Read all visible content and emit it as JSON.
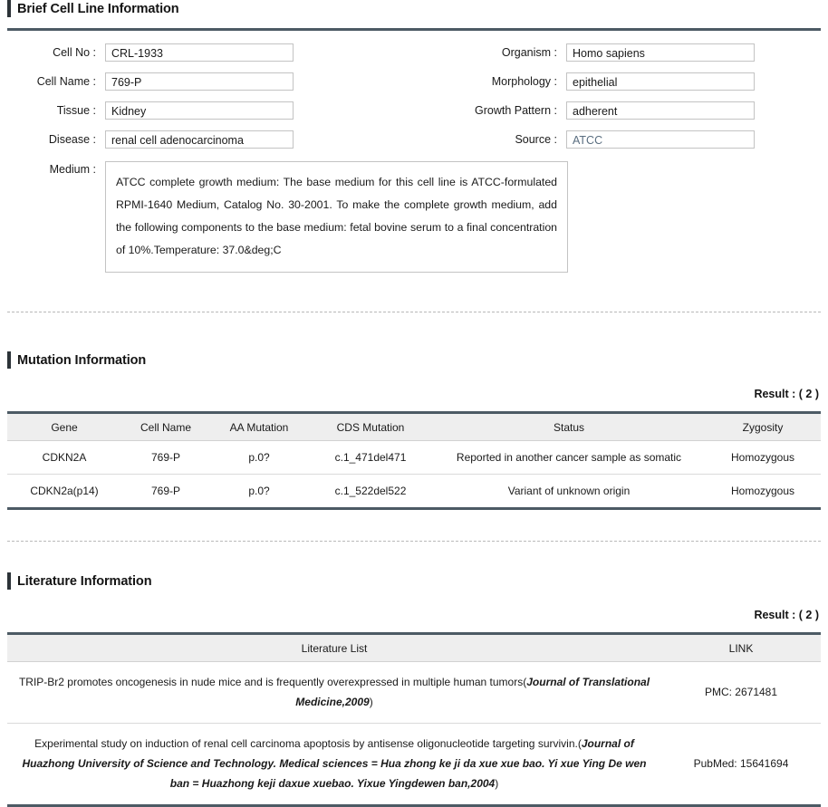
{
  "brief": {
    "section_title": "Brief Cell Line Information",
    "left_fields": [
      {
        "label": "Cell No :",
        "value": "CRL-1933",
        "muted": false
      },
      {
        "label": "Cell Name :",
        "value": "769-P",
        "muted": false
      },
      {
        "label": "Tissue :",
        "value": "Kidney",
        "muted": false
      },
      {
        "label": "Disease :",
        "value": "renal cell adenocarcinoma",
        "muted": false
      }
    ],
    "right_fields": [
      {
        "label": "Organism :",
        "value": "Homo sapiens",
        "muted": false
      },
      {
        "label": "Morphology :",
        "value": "epithelial",
        "muted": false
      },
      {
        "label": "Growth Pattern :",
        "value": "adherent",
        "muted": false
      },
      {
        "label": "Source :",
        "value": "ATCC",
        "muted": true
      }
    ],
    "medium_label": "Medium :",
    "medium_value": "ATCC complete growth medium: The base medium for this cell line is ATCC-formulated RPMI-1640 Medium, Catalog No. 30-2001. To make the complete growth medium, add the following components to the base medium: fetal bovine serum to a final concentration of 10%.Temperature: 37.0&deg;C"
  },
  "mutation": {
    "section_title": "Mutation Information",
    "result_label": "Result : ( 2 )",
    "columns": [
      "Gene",
      "Cell Name",
      "AA Mutation",
      "CDS Mutation",
      "Status",
      "Zygosity"
    ],
    "rows": [
      {
        "gene": "CDKN2A",
        "cell_name": "769-P",
        "aa_mutation": "p.0?",
        "cds_mutation": "c.1_471del471",
        "status": "Reported in another cancer sample as somatic",
        "zygosity": "Homozygous"
      },
      {
        "gene": "CDKN2a(p14)",
        "cell_name": "769-P",
        "aa_mutation": "p.0?",
        "cds_mutation": "c.1_522del522",
        "status": "Variant of unknown origin",
        "zygosity": "Homozygous"
      }
    ]
  },
  "literature": {
    "section_title": "Literature Information",
    "result_label": "Result : ( 2 )",
    "columns": [
      "Literature List",
      "LINK"
    ],
    "rows": [
      {
        "title": "TRIP-Br2 promotes oncogenesis in nude mice and is frequently overexpressed in multiple human tumors(",
        "journal": "Journal of Translational Medicine,",
        "year": "2009",
        "close": ")",
        "link": "PMC: 2671481"
      },
      {
        "title": "Experimental study on induction of renal cell carcinoma apoptosis by antisense oligonucleotide targeting survivin.(",
        "journal": "Journal of Huazhong University of Science and Technology. Medical sciences = Hua zhong ke ji da xue xue bao. Yi xue Ying De wen ban = Huazhong keji daxue xuebao. Yixue Yingdewen ban,",
        "year": "2004",
        "close": ")",
        "link": "PubMed: 15641694"
      }
    ]
  },
  "colors": {
    "accent_bar": "#2c3338",
    "rule": "#4c5a64",
    "link_text": "#4e7d98",
    "literature_text": "#2f5f80",
    "table_header_bg": "#eeeeee"
  }
}
